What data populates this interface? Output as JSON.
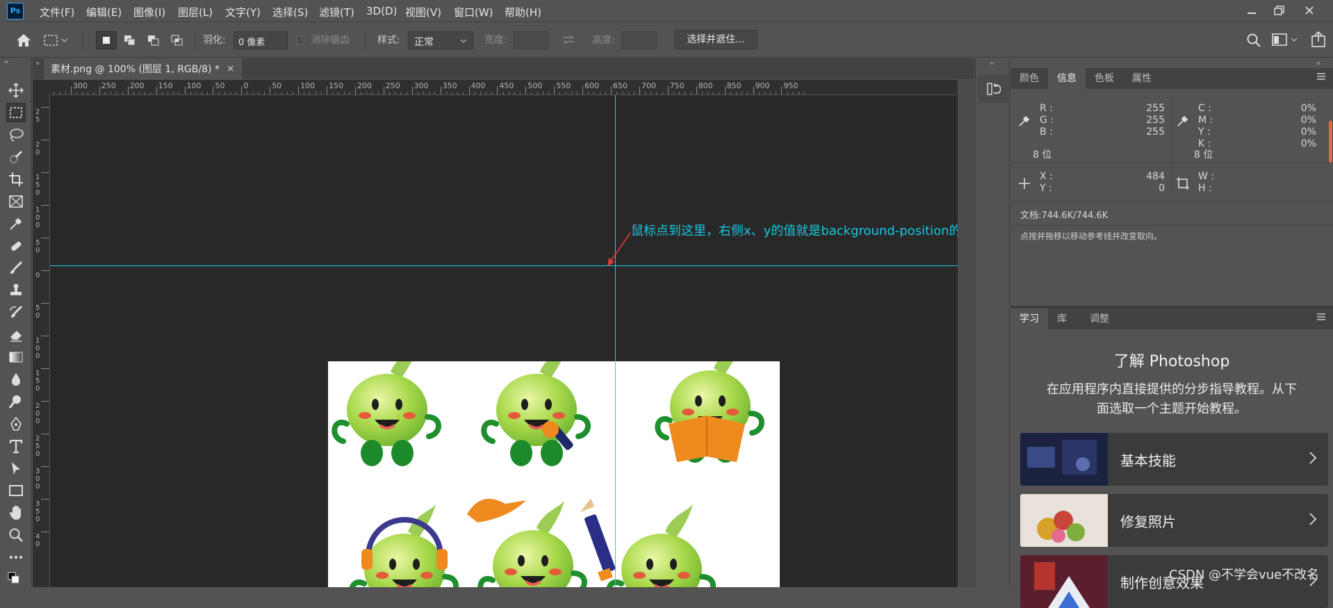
{
  "app": {
    "logo": "Ps"
  },
  "menu": [
    "文件(F)",
    "编辑(E)",
    "图像(I)",
    "图层(L)",
    "文字(Y)",
    "选择(S)",
    "滤镜(T)",
    "3D(D)",
    "视图(V)",
    "窗口(W)",
    "帮助(H)"
  ],
  "options": {
    "feather_label": "羽化:",
    "feather_value": "0 像素",
    "antialias_label": "消除锯齿",
    "style_label": "样式:",
    "style_value": "正常",
    "width_label": "宽度:",
    "height_label": "高度:",
    "select_mask_button": "选择并遮住..."
  },
  "document_tab": {
    "title": "素材.png @ 100% (图层 1, RGB/8) *",
    "close": "×"
  },
  "rulers": {
    "horizontal": [
      "0",
      "300",
      "250",
      "200",
      "150",
      "100",
      "50",
      "0",
      "50",
      "100",
      "150",
      "200",
      "250",
      "300",
      "350",
      "400",
      "450",
      "500",
      "550",
      "600",
      "650",
      "700",
      "750",
      "800",
      "850",
      "900",
      "950"
    ],
    "vertical": [
      "2\n0",
      "2\n5",
      "2\n0",
      "1\n5\n0",
      "1\n0\n0",
      "5\n0",
      "0",
      "5\n0",
      "1\n0\n0",
      "1\n5\n0",
      "2\n0\n0",
      "2\n5\n0",
      "3\n0\n0",
      "3\n5\n0",
      "4\n0"
    ]
  },
  "annotation": "鼠标点到这里，右侧x、y的值就是background-position的值",
  "panels": {
    "top_tabs": [
      "颜色",
      "信息",
      "色板",
      "属性"
    ],
    "active_top_tab": "信息",
    "info": {
      "rgb": [
        {
          "label": "R :",
          "value": "255"
        },
        {
          "label": "G :",
          "value": "255"
        },
        {
          "label": "B :",
          "value": "255"
        }
      ],
      "rgb_bits": "8 位",
      "cmyk": [
        {
          "label": "C :",
          "value": "0%"
        },
        {
          "label": "M :",
          "value": "0%"
        },
        {
          "label": "Y :",
          "value": "0%"
        },
        {
          "label": "K :",
          "value": "0%"
        }
      ],
      "cmyk_bits": "8 位",
      "xy": [
        {
          "label": "X :",
          "value": "484"
        },
        {
          "label": "Y :",
          "value": "0"
        }
      ],
      "wh": [
        {
          "label": "W :",
          "value": ""
        },
        {
          "label": "H :",
          "value": ""
        }
      ],
      "doc": "文档:744.6K/744.6K",
      "hint": "点按并拖移以移动参考线并改变取向。"
    },
    "bottom_tabs": [
      "学习",
      "库",
      "调整"
    ],
    "active_bottom_tab": "学习",
    "learn": {
      "title": "了解 Photoshop",
      "desc_line1": "在应用程序内直接提供的分步指导教程。从下",
      "desc_line2": "面选取一个主题开始教程。",
      "cards": [
        "基本技能",
        "修复照片",
        "制作创意效果"
      ]
    }
  },
  "watermark": "CSDN @不学会vue不改名",
  "colors": {
    "guide": "#18d5e8",
    "annotation": "#18c8e0",
    "character_green": "#8fcc3a",
    "accent_orange": "#ef8a1e"
  }
}
